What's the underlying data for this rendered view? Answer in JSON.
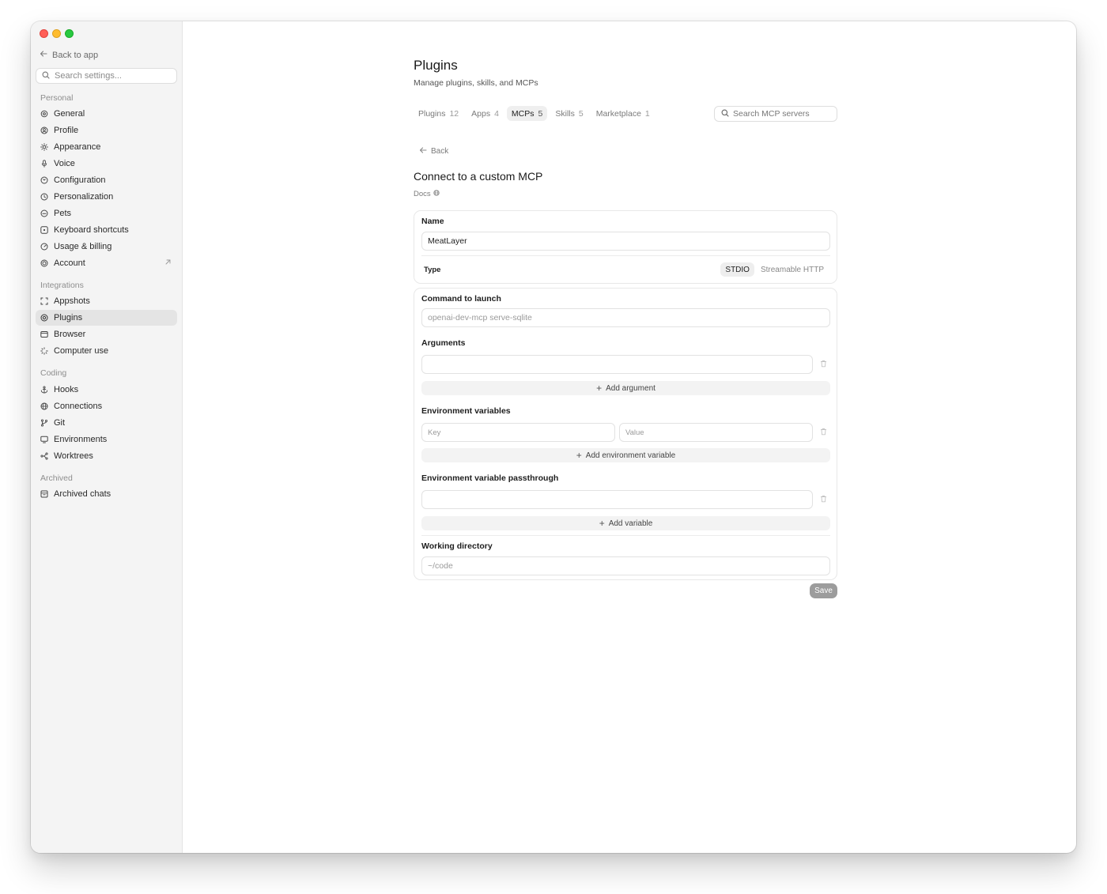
{
  "sidebar": {
    "back_label": "Back to app",
    "search_placeholder": "Search settings...",
    "sections": {
      "personal": "Personal",
      "integrations": "Integrations",
      "coding": "Coding",
      "archived": "Archived"
    },
    "items": {
      "general": "General",
      "profile": "Profile",
      "appearance": "Appearance",
      "voice": "Voice",
      "configuration": "Configuration",
      "personalization": "Personalization",
      "pets": "Pets",
      "keyboard_shortcuts": "Keyboard shortcuts",
      "usage_billing": "Usage & billing",
      "account": "Account",
      "appshots": "Appshots",
      "plugins": "Plugins",
      "browser": "Browser",
      "computer_use": "Computer use",
      "hooks": "Hooks",
      "connections": "Connections",
      "git": "Git",
      "environments": "Environments",
      "worktrees": "Worktrees",
      "archived_chats": "Archived chats"
    },
    "active_item": "plugins"
  },
  "header": {
    "title": "Plugins",
    "subtitle": "Manage plugins, skills, and MCPs"
  },
  "tabs": [
    {
      "label": "Plugins",
      "count": "12"
    },
    {
      "label": "Apps",
      "count": "4"
    },
    {
      "label": "MCPs",
      "count": "5"
    },
    {
      "label": "Skills",
      "count": "5"
    },
    {
      "label": "Marketplace",
      "count": "1"
    }
  ],
  "active_tab": "MCPs",
  "mcp_search": {
    "placeholder": "Search MCP servers"
  },
  "form": {
    "back_label": "Back",
    "title": "Connect to a custom MCP",
    "docs_label": "Docs",
    "name_label": "Name",
    "name_value": "MeatLayer",
    "type_label": "Type",
    "type_options": [
      "STDIO",
      "Streamable HTTP"
    ],
    "type_selected": "STDIO",
    "command_label": "Command to launch",
    "command_placeholder": "openai-dev-mcp serve-sqlite",
    "arguments_label": "Arguments",
    "add_argument_label": "Add argument",
    "env_label": "Environment variables",
    "env_key_placeholder": "Key",
    "env_value_placeholder": "Value",
    "add_env_label": "Add environment variable",
    "passthrough_label": "Environment variable passthrough",
    "add_variable_label": "Add variable",
    "workdir_label": "Working directory",
    "workdir_placeholder": "~/code",
    "save_label": "Save"
  },
  "colors": {
    "sidebar_bg": "#f4f4f4",
    "active_item_bg": "#e4e4e4",
    "save_disabled": "#9c9c9c",
    "traffic_red": "#ff5f57",
    "traffic_yellow": "#febc2e",
    "traffic_green": "#28c840"
  }
}
